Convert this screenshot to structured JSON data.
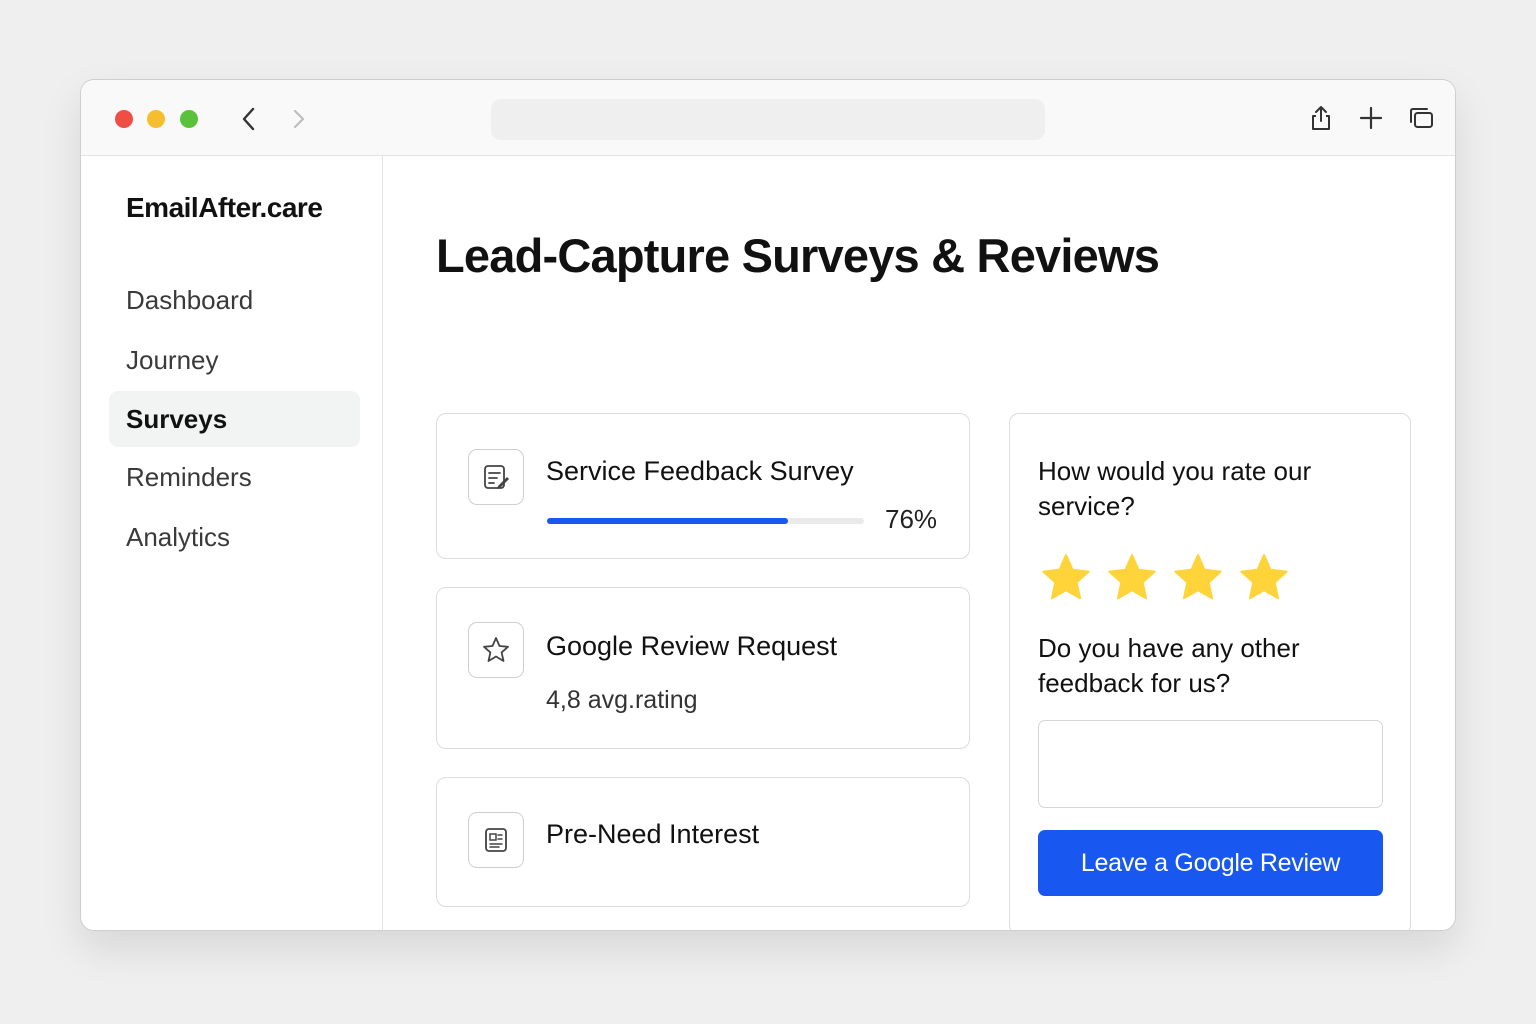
{
  "browser": {
    "url": "",
    "icons": [
      "chevron-left-icon",
      "chevron-right-icon",
      "share-icon",
      "plus-icon",
      "tabs-icon"
    ]
  },
  "sidebar": {
    "brand": "EmailAfter.care",
    "items": [
      {
        "label": "Dashboard",
        "active": false
      },
      {
        "label": "Journey",
        "active": false
      },
      {
        "label": "Surveys",
        "active": true
      },
      {
        "label": "Reminders",
        "active": false
      },
      {
        "label": "Analytics",
        "active": false
      }
    ]
  },
  "main": {
    "title": "Lead-Capture Surveys & Reviews",
    "cards": [
      {
        "title": "Service Feedback Survey",
        "icon": "survey-edit-icon",
        "progress_percent": 76,
        "progress_label": "76%"
      },
      {
        "title": "Google Review Request",
        "icon": "star-outline-icon",
        "rating": "4,8",
        "rating_suffix": "avg.rating"
      },
      {
        "title": "Pre-Need Interest",
        "icon": "form-icon"
      }
    ]
  },
  "review_widget": {
    "question_rate": "How would you rate our service?",
    "stars_filled": 4,
    "star_color": "#FFD43B",
    "question_feedback": "Do you have any other feedback for us?",
    "feedback_value": "",
    "feedback_placeholder": "",
    "cta_label": "Leave a Google Review"
  },
  "colors": {
    "accent": "#1858F0",
    "active_nav_bg": "#F2F3F3",
    "traffic_red": "#EE4E44",
    "traffic_yellow": "#F5BE2E",
    "traffic_green": "#5AC13B"
  }
}
